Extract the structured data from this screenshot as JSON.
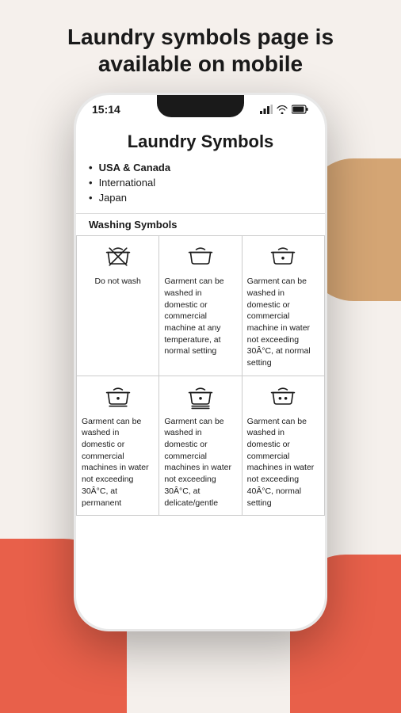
{
  "page": {
    "title": "Laundry symbols page is\navailable on mobile"
  },
  "status_bar": {
    "time": "15:14"
  },
  "app": {
    "title": "Laundry Symbols",
    "nav_items": [
      {
        "label": "USA & Canada",
        "active": true
      },
      {
        "label": "International",
        "active": false
      },
      {
        "label": "Japan",
        "active": false
      }
    ],
    "section_header": "Washing Symbols",
    "symbols": [
      {
        "description": "Do not wash"
      },
      {
        "description": "Garment can be washed in domestic or commercial machine at any temperature, at normal setting"
      },
      {
        "description": "Garment can be washed in domestic or commercial machine in water not exceeding 30Â°C, at normal setting"
      },
      {
        "description": "Garment can be washed in domestic or commercial machines in water not exceeding 30Â°C, at permanent"
      },
      {
        "description": "Garment can be washed in domestic or commercial machines in water not exceeding 30Â°C, at delicate/gentle"
      },
      {
        "description": "Garment can be washed in domestic or commercial machines in water not exceeding 40Â°C, normal setting"
      }
    ]
  }
}
